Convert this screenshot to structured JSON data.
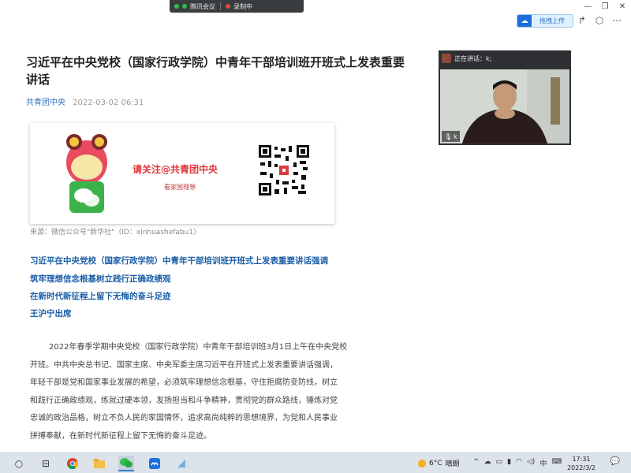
{
  "meeting_bar": {
    "app_label": "腾讯会议",
    "recording_label": "录制中"
  },
  "toolbar": {
    "upload_label": "拖拽上传"
  },
  "article": {
    "title": "习近平在中央党校（国家行政学院）中青年干部培训班开班式上发表重要讲话",
    "source": "共青团中央",
    "timestamp": "2022-03-02 06:31",
    "banner_follow": "请关注@共青团中央",
    "banner_sub": "看家国理想",
    "source_note": "来源：微信公众号\"新华社\"（ID：xinhuashefabu1）",
    "headlines": [
      "习近平在中央党校（国家行政学院）中青年干部培训班开班式上发表重要讲话强调",
      "筑牢理想信念根基树立践行正确政绩观",
      "在新时代新征程上留下无悔的奋斗足迹",
      "王沪宁出席"
    ],
    "body_lines": [
      "2022年春季学期中央党校（国家行政学院）中青年干部培训班3月1日上午在中央党校",
      "开班。中共中央总书记、国家主席、中央军委主席习近平在开班式上发表重要讲话强调，",
      "年轻干部是党和国家事业发展的希望，必须筑牢理想信念根基，守住拒腐防变防线，树立",
      "和践行正确政绩观，练就过硬本领，发扬担当和斗争精神，贯彻党的群众路线，锤炼对党",
      "忠诚的政治品格，树立不负人民的家国情怀，追求高尚纯粹的思想境界，为党和人民事业",
      "拼搏奉献，在新时代新征程上留下无悔的奋斗足迹。"
    ]
  },
  "video": {
    "speaking_label": "正在讲话：k;",
    "participant": "k"
  },
  "taskbar": {
    "weather_temp": "6°C",
    "weather_desc": "晴朗",
    "ime": "中",
    "time": "17:31",
    "date": "2022/3/2"
  },
  "colors": {
    "link_blue": "#1a5ea8",
    "accent_red": "#d9393b"
  }
}
